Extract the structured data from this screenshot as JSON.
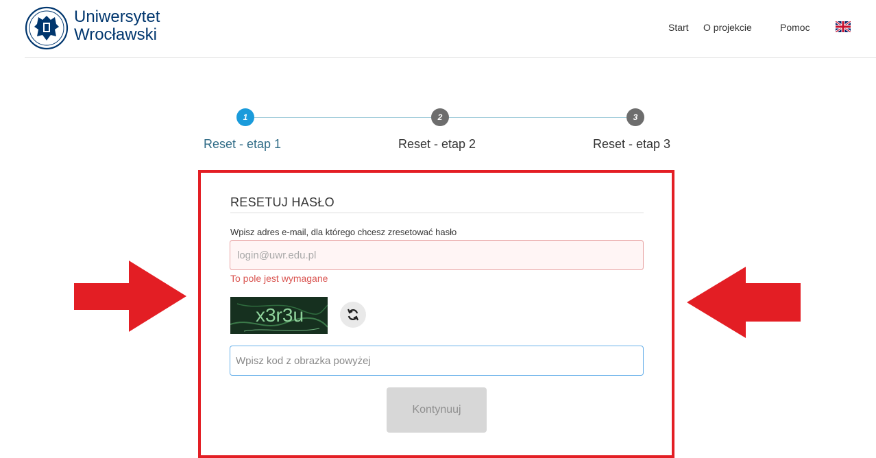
{
  "header": {
    "brand_line1": "Uniwersytet",
    "brand_line2": "Wrocławski",
    "nav": [
      "Start",
      "O projekcie",
      "Pomoc"
    ],
    "language_icon": "uk-flag-icon"
  },
  "stepper": {
    "steps": [
      {
        "number": "1",
        "label": "Reset - etap 1",
        "state": "active"
      },
      {
        "number": "2",
        "label": "Reset - etap 2",
        "state": "inactive"
      },
      {
        "number": "3",
        "label": "Reset - etap 3",
        "state": "inactive"
      }
    ]
  },
  "form": {
    "title": "RESETUJ HASŁO",
    "email_label": "Wpisz adres e-mail, dla którego chcesz zresetować hasło",
    "email_placeholder": "login@uwr.edu.pl",
    "email_error": "To pole jest wymagane",
    "captcha_text": "x3r3u",
    "refresh_icon": "refresh-icon",
    "code_placeholder": "Wpisz kod z obrazka powyżej",
    "submit_label": "Kontynuuj"
  },
  "colors": {
    "brand": "#00366e",
    "step_active": "#1a9bdb",
    "step_inactive": "#6d6d6d",
    "highlight": "#e31e24",
    "error": "#d9534f"
  }
}
